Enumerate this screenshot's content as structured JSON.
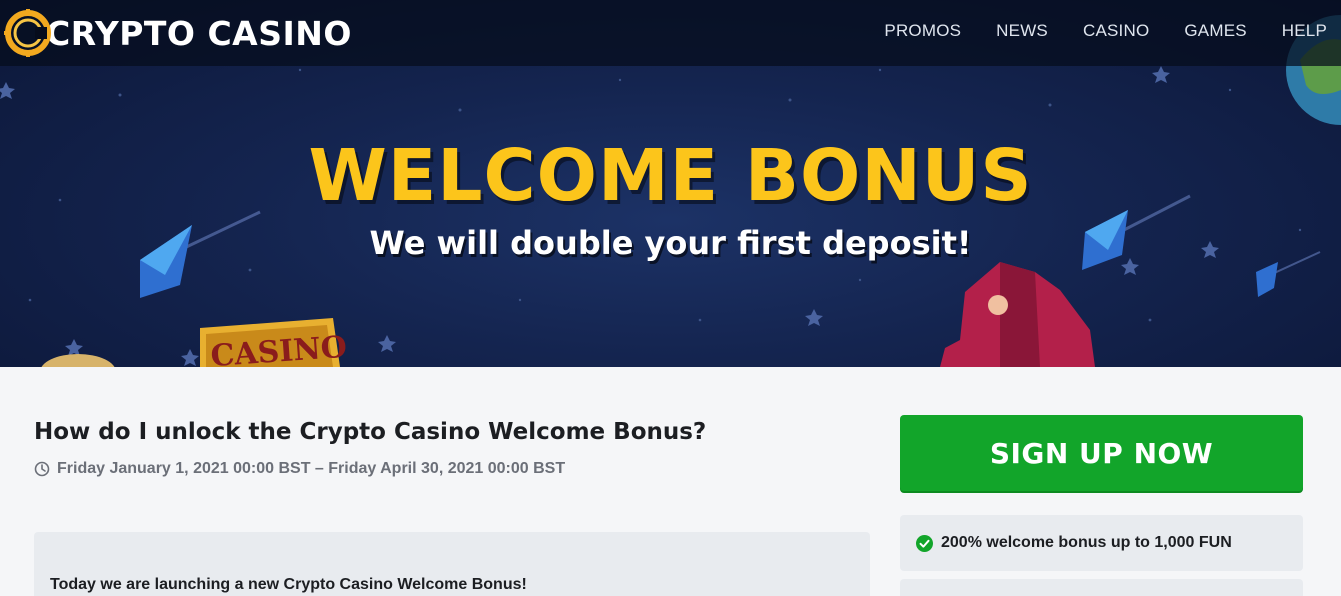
{
  "brand": {
    "name": "CRYPTO CASINO"
  },
  "nav": {
    "items": [
      "PROMOS",
      "NEWS",
      "CASINO",
      "GAMES",
      "HELP"
    ]
  },
  "hero": {
    "title": "WELCOME BONUS",
    "subtitle": "We will double your first deposit!",
    "sign_text": "CASINO"
  },
  "promo": {
    "heading": "How do I unlock the Crypto Casino Welcome Bonus?",
    "dates": "Friday January 1, 2021 00:00 BST – Friday April 30, 2021 00:00 BST",
    "intro": "Today we are launching a new Crypto Casino Welcome Bonus!"
  },
  "sidebar": {
    "cta_label": "SIGN UP NOW",
    "benefits": [
      "200% welcome bonus up to 1,000 FUN"
    ]
  },
  "colors": {
    "accent": "#fcc51b",
    "cta": "#12a52a",
    "hero_bg": "#14244f"
  },
  "icons": {
    "clock": "clock-icon",
    "check": "check-circle-icon",
    "logo": "coin-logo-icon"
  }
}
